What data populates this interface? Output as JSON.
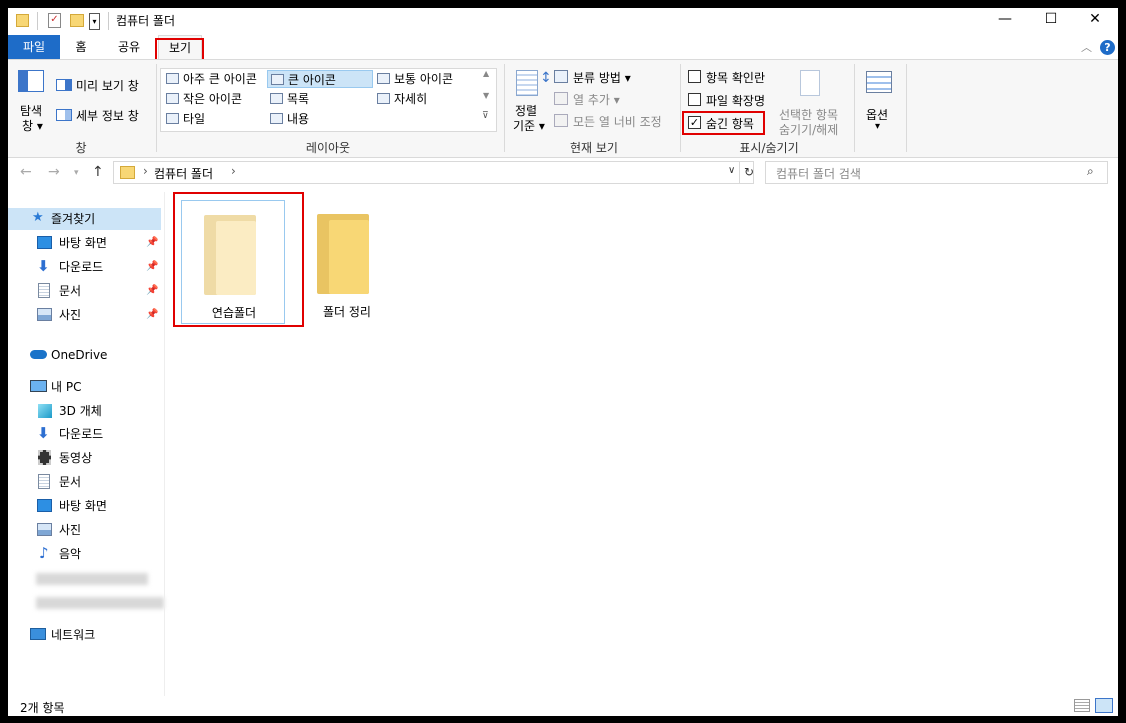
{
  "window": {
    "title": "컴퓨터 폴더"
  },
  "tabs": {
    "file": "파일",
    "home": "홈",
    "share": "공유",
    "view": "보기"
  },
  "ribbon": {
    "pane": {
      "nav_pane": "탐색\n창",
      "nav_pane_l1": "탐색",
      "nav_pane_l2": "창 ▾",
      "preview_pane": "미리 보기 창",
      "details_pane": "세부 정보 창",
      "group_label": "창"
    },
    "layout": {
      "items": [
        "아주 큰 아이콘",
        "큰 아이콘",
        "보통 아이콘",
        "작은 아이콘",
        "목록",
        "자세히",
        "타일",
        "내용"
      ],
      "selected": "큰 아이콘",
      "group_label": "레이아웃"
    },
    "current_view": {
      "sort_l1": "정렬",
      "sort_l2": "기준 ▾",
      "group_by": "분류 방법 ▾",
      "add_column": "열 추가 ▾",
      "fit_columns": "모든 열 너비 조정",
      "group_label": "현재 보기"
    },
    "show_hide": {
      "item_checkboxes": "항목 확인란",
      "file_extensions": "파일 확장명",
      "hidden_items": "숨긴 항목",
      "hidden_items_checked": true,
      "hide_selected_l1": "선택한 항목",
      "hide_selected_l2": "숨기기/해제",
      "group_label": "표시/숨기기"
    },
    "options": {
      "label": "옵션",
      "arrow": "▾"
    }
  },
  "address": {
    "path": "컴퓨터 폴더",
    "search_placeholder": "컴퓨터 폴더 검색"
  },
  "nav": {
    "quick_access": "즐겨찾기",
    "quick_items": [
      "바탕 화면",
      "다운로드",
      "문서",
      "사진"
    ],
    "onedrive": "OneDrive",
    "this_pc": "내 PC",
    "pc_items": [
      "3D 개체",
      "다운로드",
      "동영상",
      "문서",
      "바탕 화면",
      "사진",
      "음악"
    ],
    "network": "네트워크"
  },
  "files": [
    {
      "name": "연습폴더",
      "selected": true
    },
    {
      "name": "폴더 정리",
      "selected": false
    }
  ],
  "status": {
    "count": "2개 항목"
  },
  "colors": {
    "accent": "#1e6cc8",
    "highlight_box": "#e00000",
    "folder": "#f8d775"
  }
}
